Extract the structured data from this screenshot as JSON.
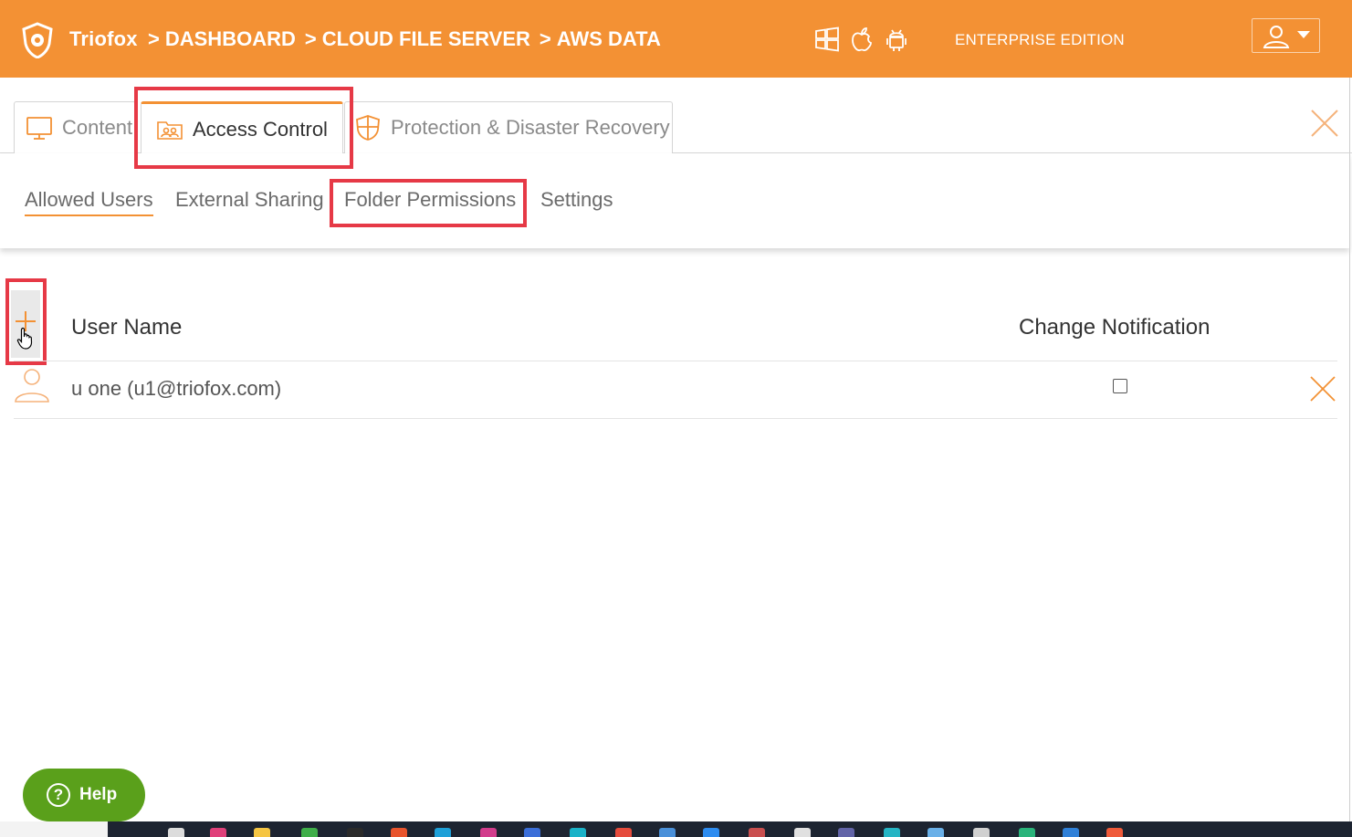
{
  "header": {
    "brand": "Triofox",
    "breadcrumbs": [
      "DASHBOARD",
      "CLOUD FILE SERVER",
      "AWS DATA"
    ],
    "breadcrumb_separator": ">",
    "platform_icons": [
      "windows-icon",
      "apple-icon",
      "android-icon"
    ],
    "edition": "ENTERPRISE EDITION",
    "user_menu_icon": "user-icon"
  },
  "tabs": [
    {
      "label": "Content",
      "icon": "monitor-icon",
      "active": false
    },
    {
      "label": "Access Control",
      "icon": "users-folder-icon",
      "active": true
    },
    {
      "label": "Protection & Disaster Recovery",
      "icon": "shield-icon",
      "active": false
    }
  ],
  "subnav": [
    {
      "label": "Allowed Users",
      "active": true
    },
    {
      "label": "External Sharing",
      "active": false
    },
    {
      "label": "Folder Permissions",
      "active": false
    },
    {
      "label": "Settings",
      "active": false
    }
  ],
  "table": {
    "columns": [
      "User Name",
      "Change Notification"
    ],
    "rows": [
      {
        "user": "u one (u1@triofox.com)",
        "change_notification": false
      }
    ]
  },
  "help": {
    "label": "Help"
  },
  "colors": {
    "accent": "#f39134",
    "highlight": "#e63946",
    "help": "#5aa01b"
  }
}
